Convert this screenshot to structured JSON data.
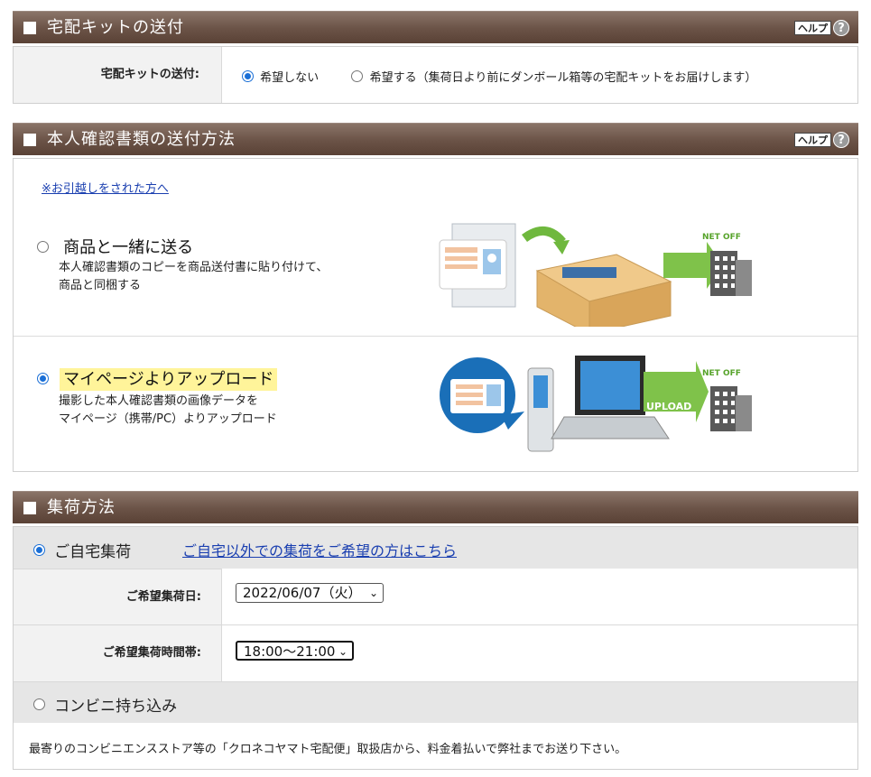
{
  "help": {
    "label": "ヘルプ",
    "icon": "question-icon",
    "icon_glyph": "?"
  },
  "kit_section": {
    "title": "宅配キットの送付",
    "field_label": "宅配キットの送付:",
    "options": [
      {
        "label": "希望しない",
        "selected": true
      },
      {
        "label": "希望する（集荷日より前にダンボール箱等の宅配キットをお届けします）",
        "selected": false
      }
    ]
  },
  "id_section": {
    "title": "本人確認書類の送付方法",
    "moved_link": "※お引越しをされた方へ",
    "options": [
      {
        "title": "商品と一緒に送る",
        "desc_line1": "本人確認書類のコピーを商品送付書に貼り付けて、",
        "desc_line2": "商品と同梱する",
        "selected": false
      },
      {
        "title": "マイページよりアップロード",
        "desc_line1": "撮影した本人確認書類の画像データを",
        "desc_line2": "マイページ（携帯/PC）よりアップロード",
        "selected": true
      }
    ],
    "logo_text": "NET OFF",
    "upload_text": "UPLOAD"
  },
  "pickup_section": {
    "title": "集荷方法",
    "home_pickup": {
      "label": "ご自宅集荷",
      "selected": true
    },
    "other_link": "ご自宅以外での集荷をご希望の方はこちら",
    "date_label": "ご希望集荷日:",
    "date_value": "2022/06/07（火）",
    "time_label": "ご希望集荷時間帯:",
    "time_value": "18:00〜21:00",
    "convenience": {
      "label": "コンビニ持ち込み",
      "selected": false
    },
    "convenience_desc": "最寄りのコンビニエンスストア等の「クロネコヤマト宅配便」取扱店から、料金着払いで弊社までお送り下さい。"
  },
  "colors": {
    "header_brown": "#6a5246",
    "selected_radio": "#1a6fd6",
    "link": "#1a3fb0",
    "highlight": "#fff49a"
  }
}
